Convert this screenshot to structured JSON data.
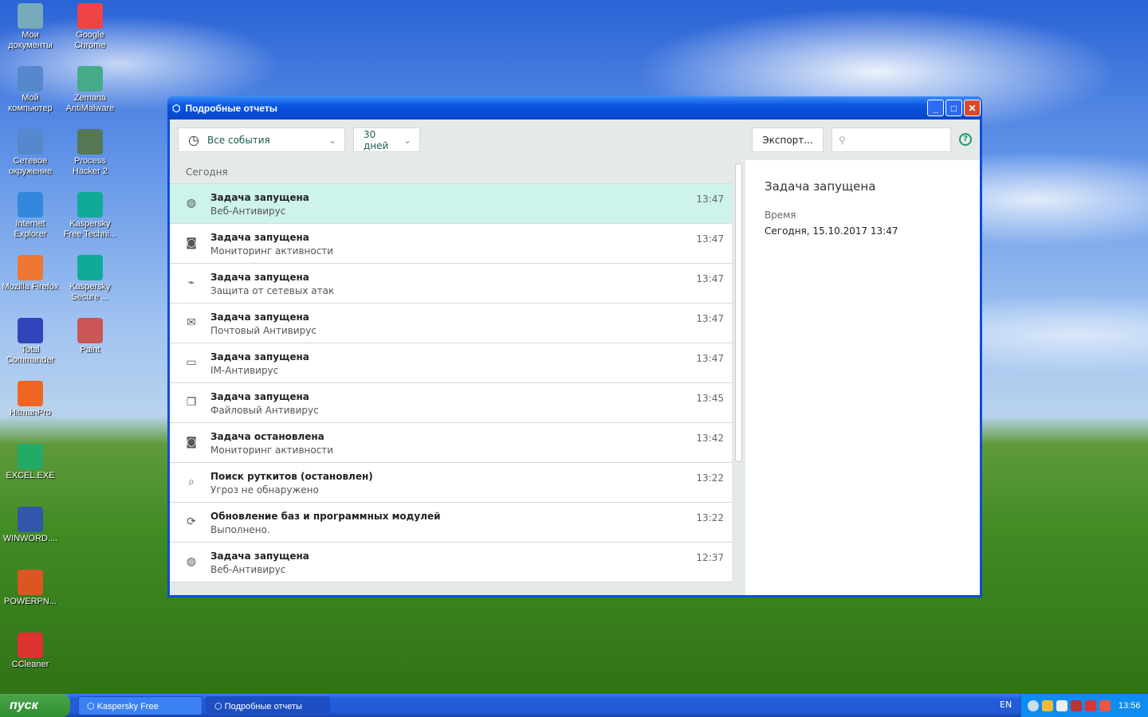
{
  "desktop": {
    "icons": [
      {
        "label": "Мои документы",
        "color": "#7ab"
      },
      {
        "label": "Google Chrome",
        "color": "#e44"
      },
      {
        "label": "Мой компьютер",
        "color": "#58c"
      },
      {
        "label": "Zemana AntiMalware",
        "color": "#4a8"
      },
      {
        "label": "Сетевое окружение",
        "color": "#58c"
      },
      {
        "label": "Process Hacker 2",
        "color": "#575"
      },
      {
        "label": "Internet Explorer",
        "color": "#38d"
      },
      {
        "label": "Kaspersky Free Techni...",
        "color": "#1a9"
      },
      {
        "label": "Mozilla Firefox",
        "color": "#e73"
      },
      {
        "label": "Kaspersky Secure ...",
        "color": "#1a9"
      },
      {
        "label": "Total Commander",
        "color": "#34b"
      },
      {
        "label": "Paint",
        "color": "#c55"
      },
      {
        "label": "HitmanPro",
        "color": "#e62"
      },
      {
        "label": "EXCEL.EXE",
        "color": "#2a6"
      },
      {
        "label": "WINWORD....",
        "color": "#35a"
      },
      {
        "label": "POWERPN...",
        "color": "#d52"
      },
      {
        "label": "CCleaner",
        "color": "#d33"
      }
    ]
  },
  "window": {
    "title": "Подробные отчеты"
  },
  "toolbar": {
    "filter": "Все события",
    "period": "30 дней",
    "export": "Экспорт...",
    "search_placeholder": "",
    "help": "?"
  },
  "list": {
    "group": "Сегодня",
    "rows": [
      {
        "icon": "globe",
        "title": "Задача запущена",
        "sub": "Веб-Антивирус",
        "time": "13:47"
      },
      {
        "icon": "monitor-eye",
        "title": "Задача запущена",
        "sub": "Мониторинг активности",
        "time": "13:47"
      },
      {
        "icon": "network-shield",
        "title": "Задача запущена",
        "sub": "Защита от сетевых атак",
        "time": "13:47"
      },
      {
        "icon": "mail",
        "title": "Задача запущена",
        "sub": "Почтовый Антивирус",
        "time": "13:47"
      },
      {
        "icon": "chat",
        "title": "Задача запущена",
        "sub": "IM-Антивирус",
        "time": "13:47"
      },
      {
        "icon": "files",
        "title": "Задача запущена",
        "sub": "Файловый Антивирус",
        "time": "13:45"
      },
      {
        "icon": "monitor-eye",
        "title": "Задача остановлена",
        "sub": "Мониторинг активности",
        "time": "13:42"
      },
      {
        "icon": "rootkit-search",
        "title": "Поиск руткитов (остановлен)",
        "sub": "Угроз не обнаружено",
        "time": "13:22"
      },
      {
        "icon": "refresh",
        "title": "Обновление баз и программных модулей",
        "sub": "Выполнено.",
        "time": "13:22"
      },
      {
        "icon": "globe",
        "title": "Задача запущена",
        "sub": "Веб-Антивирус",
        "time": "12:37"
      }
    ]
  },
  "detail": {
    "title": "Задача запущена",
    "time_label": "Время",
    "time_value": "Сегодня, 15.10.2017 13:47"
  },
  "taskbar": {
    "start": "пуск",
    "tasks": [
      "Kaspersky Free",
      "Подробные отчеты"
    ],
    "lang": "EN",
    "clock": "13:56"
  }
}
